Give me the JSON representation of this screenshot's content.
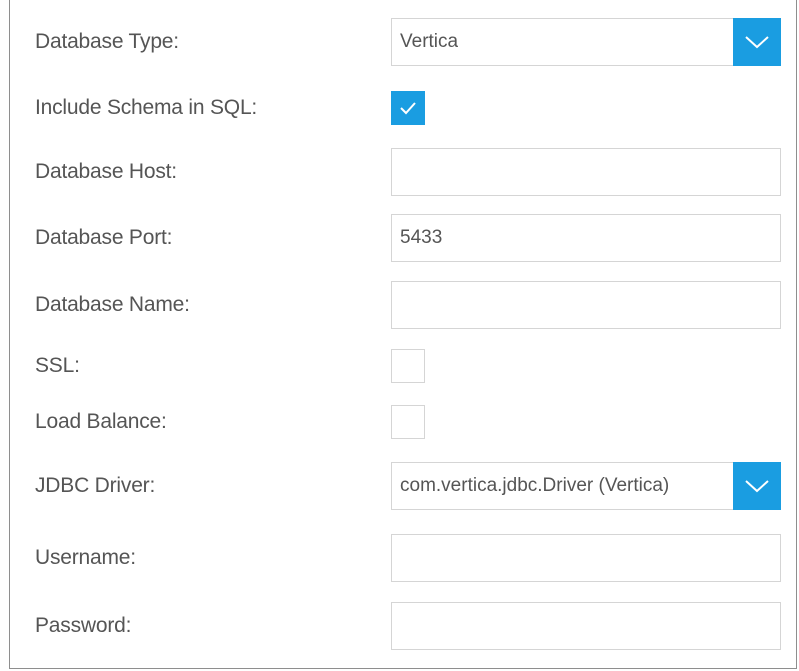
{
  "form": {
    "database_type": {
      "label": "Database Type:",
      "value": "Vertica"
    },
    "include_schema": {
      "label": "Include Schema in SQL:",
      "checked": true
    },
    "database_host": {
      "label": "Database Host:",
      "value": ""
    },
    "database_port": {
      "label": "Database Port:",
      "value": "5433"
    },
    "database_name": {
      "label": "Database Name:",
      "value": ""
    },
    "ssl": {
      "label": "SSL:",
      "checked": false
    },
    "load_balance": {
      "label": "Load Balance:",
      "checked": false
    },
    "jdbc_driver": {
      "label": "JDBC Driver:",
      "value": "com.vertica.jdbc.Driver (Vertica)"
    },
    "username": {
      "label": "Username:",
      "value": ""
    },
    "password": {
      "label": "Password:",
      "value": ""
    }
  },
  "colors": {
    "accent": "#1a9de1",
    "label_text": "#555555",
    "field_border": "#d5d5d5",
    "frame_border": "#8e8e8e"
  },
  "icons": {
    "select_arrow": "chevron-down-icon",
    "checkbox_mark": "checkmark-icon"
  }
}
